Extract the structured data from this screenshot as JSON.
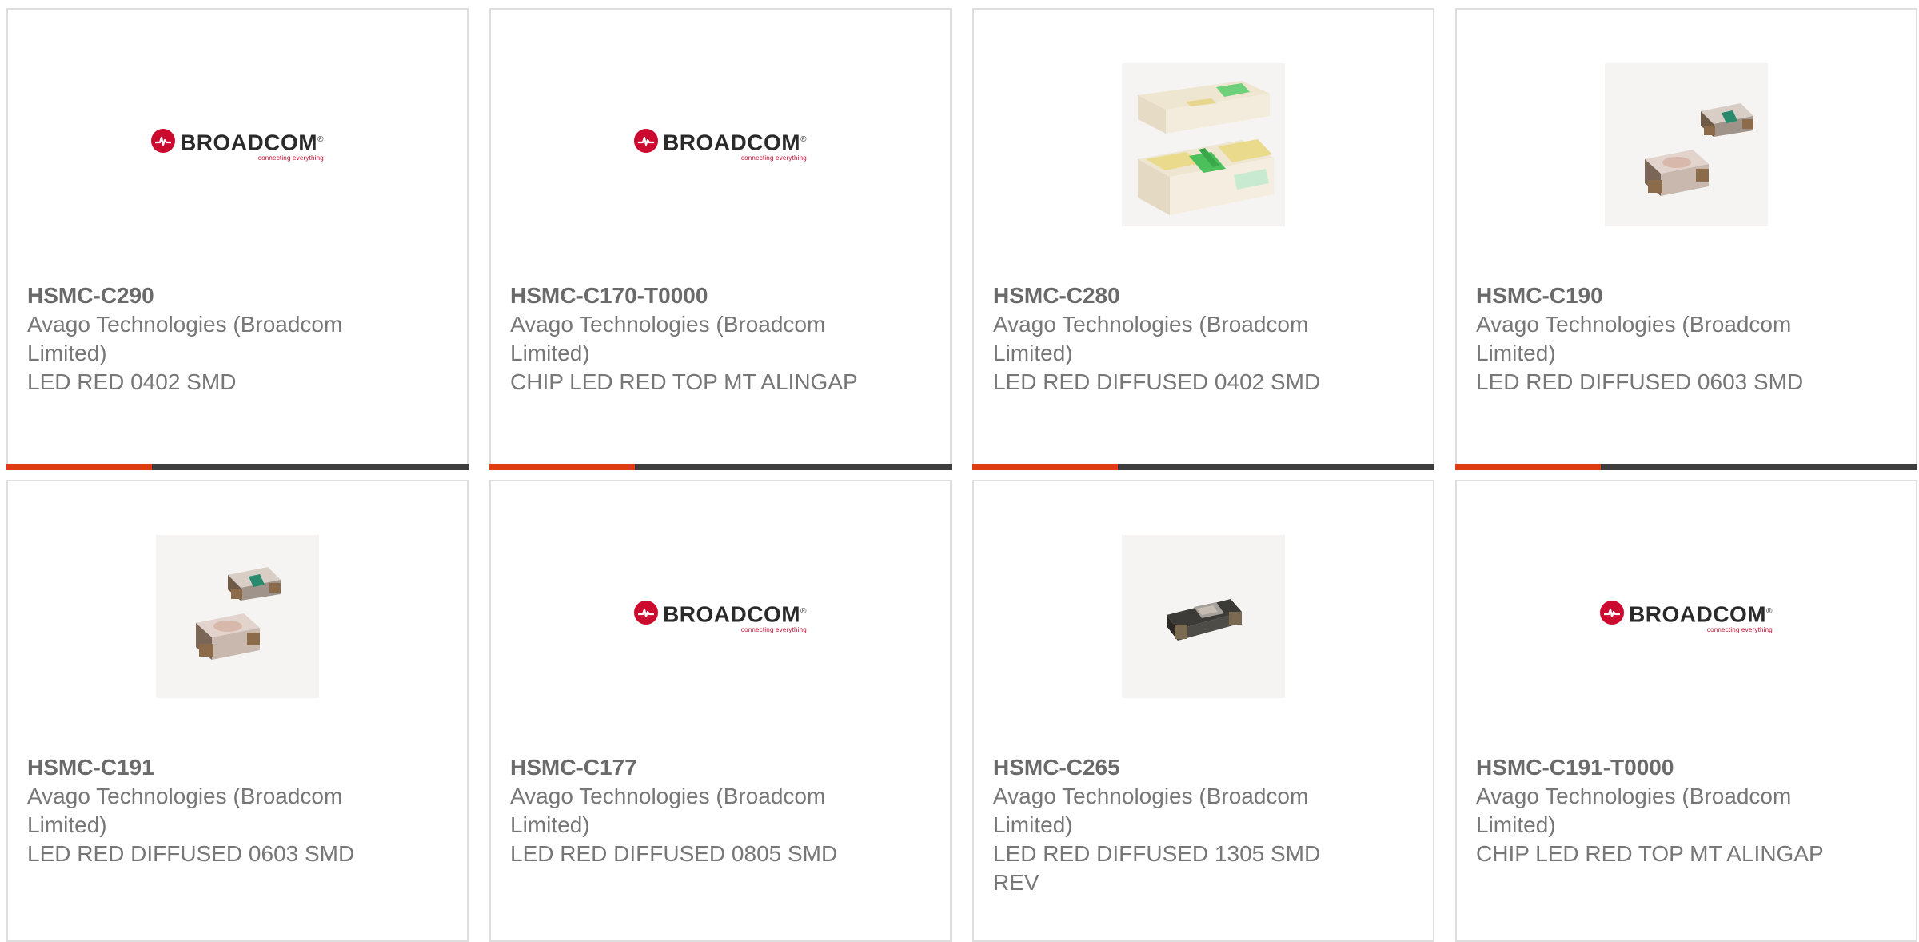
{
  "logo": {
    "name": "BROADCOM",
    "trademark": "®",
    "tagline": "connecting everything"
  },
  "colors": {
    "accent_bar": "#e03c12",
    "dark_bar": "#3d3d3d",
    "brand_red": "#cc092f"
  },
  "products": [
    {
      "part_number": "HSMC-C290",
      "manufacturer": "Avago Technologies (Broadcom Limited)",
      "description": "LED RED 0402 SMD",
      "image": "broadcom-logo"
    },
    {
      "part_number": "HSMC-C170-T0000",
      "manufacturer": "Avago Technologies (Broadcom Limited)",
      "description": "CHIP LED RED TOP MT ALINGAP",
      "image": "broadcom-logo"
    },
    {
      "part_number": "HSMC-C280",
      "manufacturer": "Avago Technologies (Broadcom Limited)",
      "description": "LED RED DIFFUSED 0402 SMD",
      "image": "led-0402-photo"
    },
    {
      "part_number": "HSMC-C190",
      "manufacturer": "Avago Technologies (Broadcom Limited)",
      "description": "LED RED DIFFUSED 0603 SMD",
      "image": "led-0603-photo"
    },
    {
      "part_number": "HSMC-C191",
      "manufacturer": "Avago Technologies (Broadcom Limited)",
      "description": "LED RED DIFFUSED 0603 SMD",
      "image": "led-0603-photo"
    },
    {
      "part_number": "HSMC-C177",
      "manufacturer": "Avago Technologies (Broadcom Limited)",
      "description": "LED RED DIFFUSED 0805 SMD",
      "image": "broadcom-logo"
    },
    {
      "part_number": "HSMC-C265",
      "manufacturer": "Avago Technologies (Broadcom Limited)",
      "description": "LED RED DIFFUSED 1305 SMD REV",
      "image": "led-1305-photo"
    },
    {
      "part_number": "HSMC-C191-T0000",
      "manufacturer": "Avago Technologies (Broadcom Limited)",
      "description": "CHIP LED RED TOP MT ALINGAP",
      "image": "broadcom-logo"
    }
  ]
}
